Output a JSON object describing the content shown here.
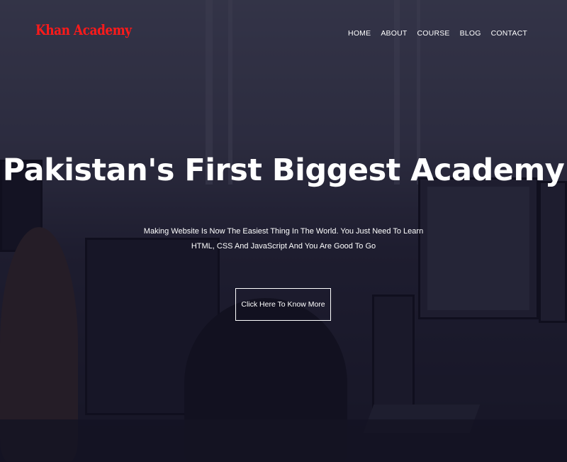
{
  "header": {
    "logo_text": "Khan Academy",
    "nav": [
      {
        "label": "HOME"
      },
      {
        "label": "ABOUT"
      },
      {
        "label": "COURSE"
      },
      {
        "label": "BLOG"
      },
      {
        "label": "CONTACT"
      }
    ]
  },
  "hero": {
    "title": "Pakistan's First Biggest Academy",
    "subtitle": "Making Website Is Now The Easiest Thing In The World. You Just Need To Learn HTML, CSS And JavaScript And You Are Good To Go",
    "cta_label": "Click Here To Know More"
  },
  "colors": {
    "logo": "#ff1a1a",
    "text": "#ffffff",
    "overlay": "#14122866"
  },
  "background_image": "office workers at computer monitors"
}
